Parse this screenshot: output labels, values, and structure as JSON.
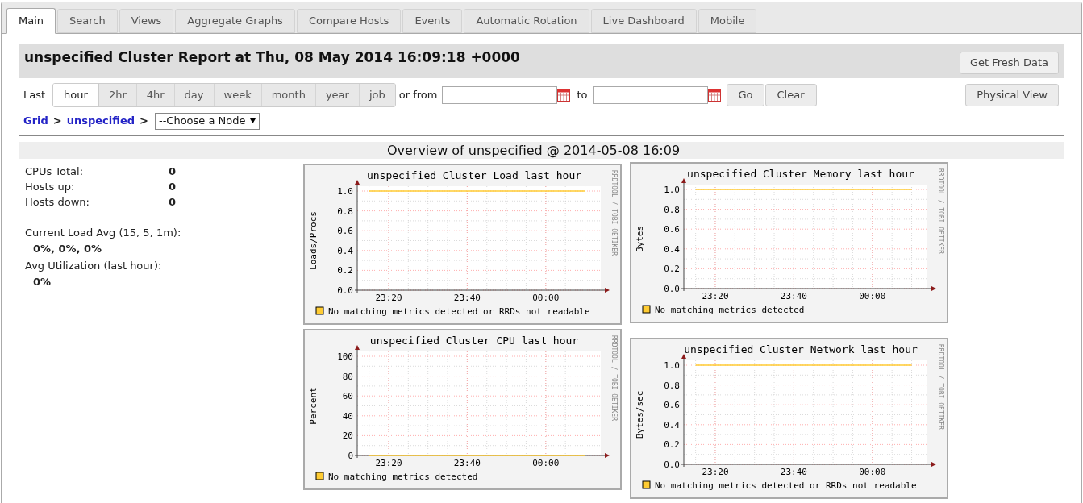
{
  "tabs": [
    {
      "label": "Main",
      "selected": true
    },
    {
      "label": "Search",
      "selected": false
    },
    {
      "label": "Views",
      "selected": false
    },
    {
      "label": "Aggregate Graphs",
      "selected": false
    },
    {
      "label": "Compare Hosts",
      "selected": false
    },
    {
      "label": "Events",
      "selected": false
    },
    {
      "label": "Automatic Rotation",
      "selected": false
    },
    {
      "label": "Live Dashboard",
      "selected": false
    },
    {
      "label": "Mobile",
      "selected": false
    }
  ],
  "header": {
    "title": "unspecified Cluster Report at Thu, 08 May 2014 16:09:18 +0000",
    "button": "Get Fresh Data"
  },
  "range": {
    "label": "Last",
    "options": [
      {
        "label": "hour",
        "selected": true
      },
      {
        "label": "2hr",
        "selected": false
      },
      {
        "label": "4hr",
        "selected": false
      },
      {
        "label": "day",
        "selected": false
      },
      {
        "label": "week",
        "selected": false
      },
      {
        "label": "month",
        "selected": false
      },
      {
        "label": "year",
        "selected": false
      },
      {
        "label": "job",
        "selected": false
      }
    ],
    "from_label": "or from",
    "to_label": "to",
    "go": "Go",
    "clear": "Clear",
    "view_button": "Physical View"
  },
  "breadcrumb": {
    "items": [
      {
        "kind": "link",
        "label": "Grid"
      },
      {
        "kind": "separator",
        "label": ">"
      },
      {
        "kind": "link",
        "label": "unspecified"
      },
      {
        "kind": "separator",
        "label": ">"
      }
    ],
    "node_select": "--Choose a Node"
  },
  "overview": {
    "title": "Overview of unspecified @ 2014-05-08 16:09",
    "stats": [
      {
        "label": "CPUs Total:",
        "value": "0"
      },
      {
        "label": "Hosts up:",
        "value": "0"
      },
      {
        "label": "Hosts down:",
        "value": "0"
      }
    ],
    "load": {
      "label": "Current Load Avg (15, 5, 1m):",
      "value": "0%, 0%, 0%"
    },
    "utilization": {
      "label": "Avg Utilization (last hour):",
      "value": "0%"
    }
  },
  "graphs": [
    {
      "credit": "RRDTOOL / TOBI OETIKER",
      "chart_data": {
        "type": "line",
        "title": "unspecified Cluster Load last hour",
        "grid": true,
        "ylabel": "Loads/Procs",
        "ylim": [
          0,
          1
        ],
        "yticks": [
          {
            "value": 0,
            "label": "0.0"
          },
          {
            "value": 0.2,
            "label": "0.2"
          },
          {
            "value": 0.4,
            "label": "0.4"
          },
          {
            "value": 0.6,
            "label": "0.6"
          },
          {
            "value": 0.8,
            "label": "0.8"
          },
          {
            "value": 1,
            "label": "1.0"
          }
        ],
        "categories": [
          null,
          "23:20",
          null,
          null,
          null,
          "23:40",
          null,
          null,
          null,
          "00:00",
          null,
          null
        ],
        "series": [
          {
            "name": "No matching metrics detected or RRDs not readable",
            "color": "#ffcc33",
            "values": [
              1,
              1,
              1,
              1,
              1,
              1,
              1,
              1,
              1,
              1,
              1,
              1
            ]
          }
        ]
      }
    },
    {
      "credit": "RRDTOOL / TOBI OETIKER",
      "chart_data": {
        "type": "line",
        "title": "unspecified Cluster Memory last hour",
        "grid": true,
        "ylabel": "Bytes",
        "ylim": [
          0,
          1
        ],
        "yticks": [
          {
            "value": 0,
            "label": "0.0"
          },
          {
            "value": 0.2,
            "label": "0.2"
          },
          {
            "value": 0.4,
            "label": "0.4"
          },
          {
            "value": 0.6,
            "label": "0.6"
          },
          {
            "value": 0.8,
            "label": "0.8"
          },
          {
            "value": 1,
            "label": "1.0"
          }
        ],
        "categories": [
          null,
          "23:20",
          null,
          null,
          null,
          "23:40",
          null,
          null,
          null,
          "00:00",
          null,
          null
        ],
        "series": [
          {
            "name": "No matching metrics detected",
            "color": "#ffcc33",
            "values": [
              1,
              1,
              1,
              1,
              1,
              1,
              1,
              1,
              1,
              1,
              1,
              1
            ]
          }
        ]
      }
    },
    {
      "credit": "RRDTOOL / TOBI OETIKER",
      "chart_data": {
        "type": "line",
        "title": "unspecified Cluster CPU last hour",
        "grid": true,
        "ylabel": "Percent",
        "ylim": [
          0,
          100
        ],
        "yticks": [
          0,
          20,
          40,
          60,
          80,
          100
        ],
        "categories": [
          null,
          "23:20",
          null,
          null,
          null,
          "23:40",
          null,
          null,
          null,
          "00:00",
          null,
          null
        ],
        "series": [
          {
            "name": "No matching metrics detected",
            "color": "#ffcc33",
            "values": [
              0,
              0,
              0,
              0,
              0,
              0,
              0,
              0,
              0,
              0,
              0,
              0
            ]
          }
        ]
      }
    },
    {
      "credit": "RRDTOOL / TOBI OETIKER",
      "chart_data": {
        "type": "line",
        "title": "unspecified Cluster Network last hour",
        "grid": true,
        "ylabel": "Bytes/sec",
        "ylim": [
          0,
          1
        ],
        "yticks": [
          {
            "value": 0,
            "label": "0.0"
          },
          {
            "value": 0.2,
            "label": "0.2"
          },
          {
            "value": 0.4,
            "label": "0.4"
          },
          {
            "value": 0.6,
            "label": "0.6"
          },
          {
            "value": 0.8,
            "label": "0.8"
          },
          {
            "value": 1,
            "label": "1.0"
          }
        ],
        "categories": [
          null,
          "23:20",
          null,
          null,
          null,
          "23:40",
          null,
          null,
          null,
          "00:00",
          null,
          null
        ],
        "series": [
          {
            "name": "No matching metrics detected or RRDs not readable",
            "color": "#ffcc33",
            "values": [
              1,
              1,
              1,
              1,
              1,
              1,
              1,
              1,
              1,
              1,
              1,
              1
            ]
          }
        ]
      }
    }
  ]
}
